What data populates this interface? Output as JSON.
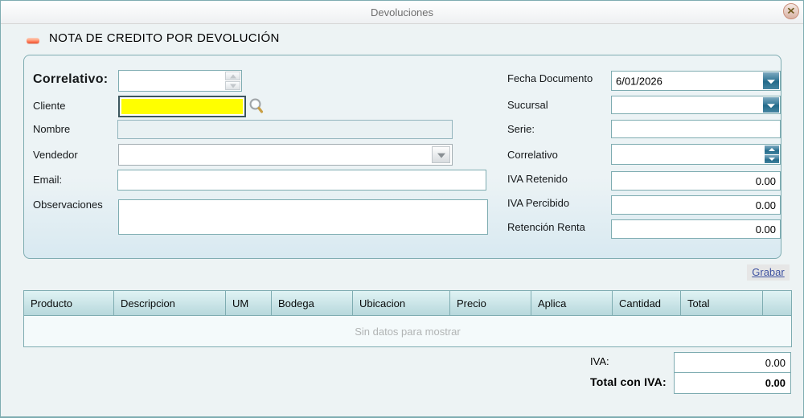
{
  "window": {
    "title": "Devoluciones"
  },
  "header": {
    "title": "NOTA DE CREDITO POR DEVOLUCIÓN"
  },
  "form": {
    "correlativo_label": "Correlativo:",
    "correlativo_value": "",
    "cliente_label": "Cliente",
    "cliente_value": "",
    "nombre_label": "Nombre",
    "nombre_value": "",
    "vendedor_label": "Vendedor",
    "vendedor_value": "",
    "email_label": "Email:",
    "email_value": "",
    "observaciones_label": "Observaciones",
    "observaciones_value": "",
    "fecha_label": "Fecha Documento",
    "fecha_value": "6/01/2026",
    "sucursal_label": "Sucursal",
    "sucursal_value": "",
    "serie_label": "Serie:",
    "serie_value": "",
    "correlativo2_label": "Correlativo",
    "correlativo2_value": "",
    "iva_retenido_label": "IVA Retenido",
    "iva_retenido_value": "0.00",
    "iva_percibido_label": "IVA Percibido",
    "iva_percibido_value": "0.00",
    "retencion_label": "Retención Renta",
    "retencion_value": "0.00"
  },
  "actions": {
    "grabar_label": "Grabar"
  },
  "table": {
    "columns": [
      "Producto",
      "Descripcion",
      "UM",
      "Bodega",
      "Ubicacion",
      "Precio",
      "Aplica",
      "Cantidad",
      "Total",
      ""
    ],
    "empty_message": "Sin datos para mostrar"
  },
  "totals": {
    "iva_label": "IVA:",
    "iva_value": "0.00",
    "total_label": "Total con IVA:",
    "total_value": "0.00"
  },
  "colors": {
    "accent_teal": "#7eacb1",
    "button_teal": "#236a8a",
    "highlight_yellow": "#ffff00",
    "link_blue": "#3d51a0",
    "header_grad_top": "#e0f3f4",
    "header_grad_bottom": "#b7d8dc"
  }
}
